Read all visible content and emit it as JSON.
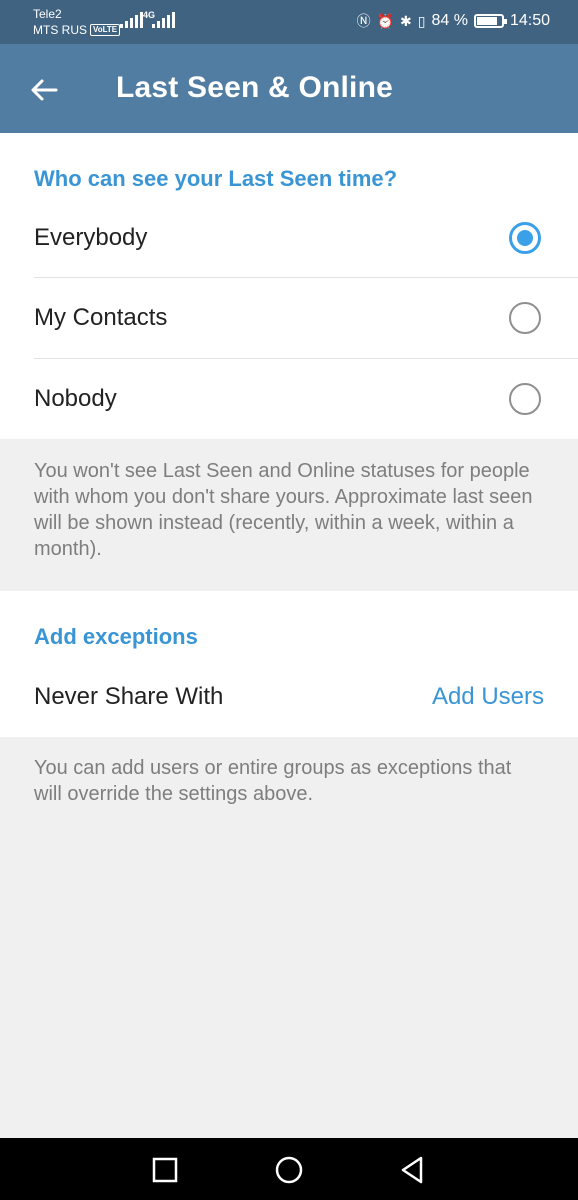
{
  "status_bar": {
    "carrier_line1": "Tele2",
    "carrier_line2": "MTS RUS",
    "volte": "VoLTE",
    "network": "4G",
    "battery_percent": "84 %",
    "battery_level": 0.84,
    "time": "14:50"
  },
  "app_bar": {
    "title": "Last Seen & Online"
  },
  "last_seen": {
    "header": "Who can see your Last Seen time?",
    "options": [
      {
        "label": "Everybody",
        "selected": true
      },
      {
        "label": "My Contacts",
        "selected": false
      },
      {
        "label": "Nobody",
        "selected": false
      }
    ],
    "info": "You won't see Last Seen and Online statuses for people with whom you don't share yours. Approximate last seen will be shown instead (recently, within a week, within a month)."
  },
  "exceptions": {
    "header": "Add exceptions",
    "never_share_label": "Never Share With",
    "add_users_label": "Add Users",
    "info": "You can add users or entire groups as exceptions that will override the settings above."
  },
  "colors": {
    "app_bar": "#517da2",
    "status_bar": "#3f6381",
    "accent": "#3a95d5",
    "radio_selected": "#3aa0e8"
  },
  "icons": {
    "back": "arrow-left-icon",
    "nav_recents": "square-icon",
    "nav_home": "circle-icon",
    "nav_back": "triangle-back-icon"
  }
}
